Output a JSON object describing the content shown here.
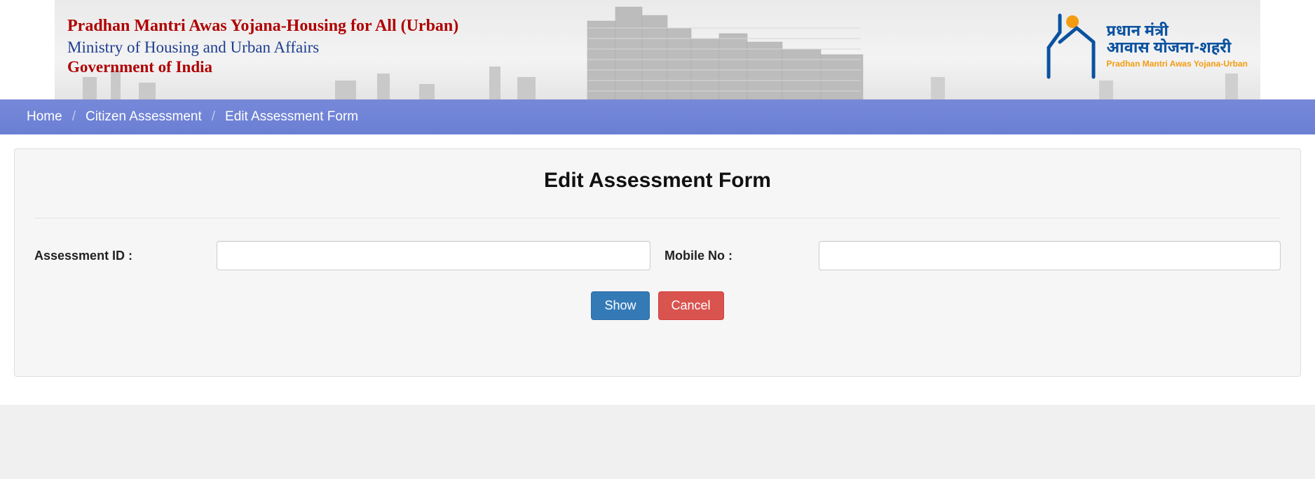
{
  "banner": {
    "line1": "Pradhan Mantri Awas Yojana-Housing for All (Urban)",
    "line2": "Ministry of Housing and Urban Affairs",
    "line3": "Government of India",
    "logo": {
      "hindi1": "प्रधान मंत्री",
      "hindi2": "आवास योजना-शहरी",
      "english": "Pradhan Mantri Awas Yojana-Urban"
    }
  },
  "breadcrumb": {
    "items": [
      "Home",
      "Citizen Assessment",
      "Edit Assessment Form"
    ]
  },
  "page": {
    "title": "Edit Assessment Form"
  },
  "form": {
    "assessment_id_label": "Assessment ID :",
    "assessment_id_value": "",
    "mobile_no_label": "Mobile No :",
    "mobile_no_value": "",
    "show_button": "Show",
    "cancel_button": "Cancel"
  }
}
